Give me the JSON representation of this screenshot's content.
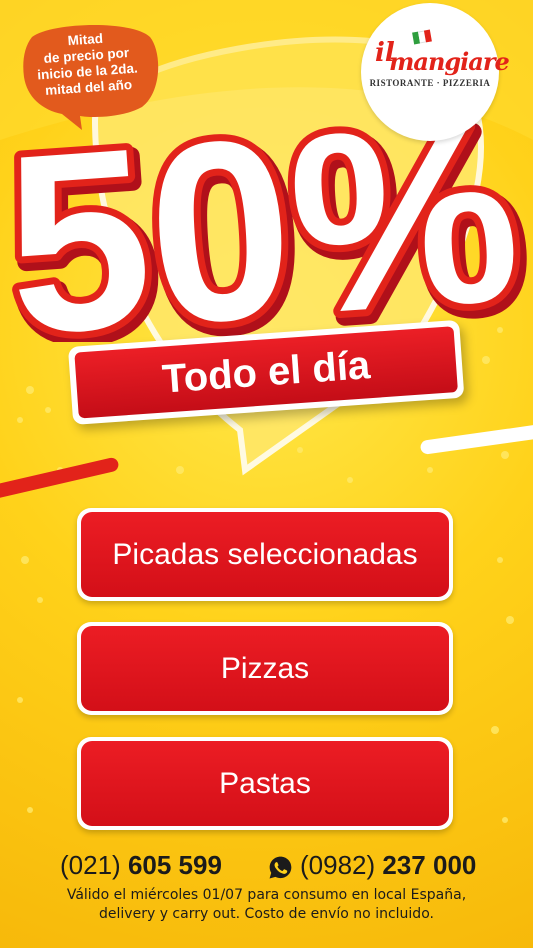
{
  "promo_bubble": {
    "lines": [
      "Mitad",
      "de precio por",
      "inicio de la 2da.",
      "mitad del año"
    ]
  },
  "logo": {
    "il": "il",
    "name": "mangiare",
    "subtitle": "RISTORANTE · PIZZERIA",
    "flag_colors": [
      "#2e9e3e",
      "#ffffff",
      "#e2231a"
    ]
  },
  "headline": {
    "percent": "50%",
    "banner": "Todo el día"
  },
  "menu": [
    {
      "label": "Picadas seleccionadas"
    },
    {
      "label": "Pizzas"
    },
    {
      "label": "Pastas"
    }
  ],
  "contact": {
    "phone1_prefix": "(021)",
    "phone1_number": "605 599",
    "phone2_prefix": "(0982)",
    "phone2_number": "237 000",
    "phone2_icon": "whatsapp-icon"
  },
  "disclaimer": {
    "line1": "Válido el miércoles 01/07 para consumo en local España,",
    "line2": "delivery y carry out. Costo de envío no incluido."
  },
  "colors": {
    "red": "#e2231a",
    "yellow": "#ffd21a",
    "white": "#ffffff"
  }
}
